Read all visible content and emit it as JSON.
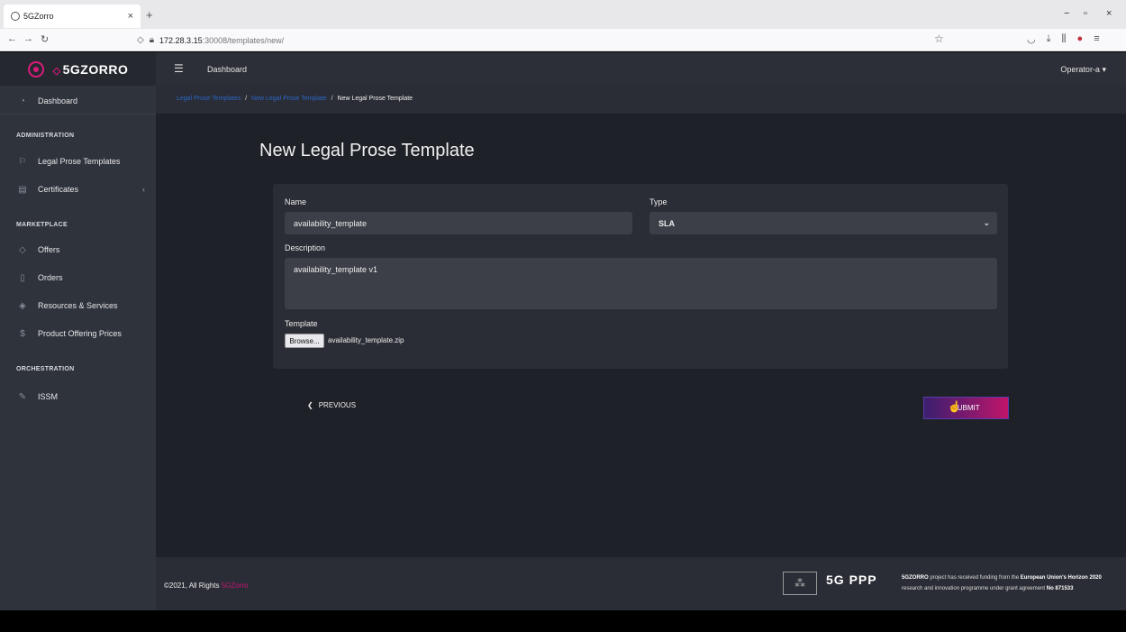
{
  "browser": {
    "tab_title": "5GZorro",
    "tab_close": "×",
    "new_tab": "+",
    "url_host": "172.28.3.15",
    "url_path": ":30008/templates/new/",
    "win_min": "−",
    "win_max": "▫",
    "win_close": "×"
  },
  "sidebar": {
    "logo": "5GZORRO",
    "items": [
      {
        "label": "Dashboard",
        "icon": "gauge-icon"
      },
      {
        "label": "Legal Prose Templates",
        "icon": "flag-icon"
      },
      {
        "label": "Certificates",
        "icon": "certificate-icon"
      },
      {
        "label": "Offers",
        "icon": "tag-icon"
      },
      {
        "label": "Orders",
        "icon": "bookmark-icon"
      },
      {
        "label": "Resources & Services",
        "icon": "layers-icon"
      },
      {
        "label": "Product Offering Prices",
        "icon": "dollar-icon"
      },
      {
        "label": "ISSM",
        "icon": "pen-icon"
      }
    ],
    "sections": {
      "administration": "ADMINISTRATION",
      "marketplace": "MARKETPLACE",
      "orchestration": "ORCHESTRATION"
    }
  },
  "topbar": {
    "title": "Dashboard",
    "user": "Operator-a"
  },
  "breadcrumb": {
    "item1": "Legal Prose Templates",
    "item2": "New Legal Prose Template",
    "current": "New Legal Prose Template",
    "sep": "/"
  },
  "form": {
    "page_title": "New Legal Prose Template",
    "name_label": "Name",
    "name_value": "availability_template",
    "type_label": "Type",
    "type_value": "SLA",
    "description_label": "Description",
    "description_value": "availability_template v1",
    "template_label": "Template",
    "browse_label": "Browse...",
    "file_name": "availability_template.zip",
    "previous_label": "PREVIOUS",
    "submit_label": "SUBMIT"
  },
  "footer": {
    "copyright": "©2021, All Rights",
    "brand": "5GZorro",
    "ppp": "5G PPP",
    "funding_lead": "5GZORRO",
    "funding_text": "project has received funding from the",
    "funding_prog": "European Union's Horizon 2020",
    "funding_text2": "research and innovation programme under grant agreement",
    "grant": "No 871533"
  },
  "colors": {
    "accent": "#d81b7a",
    "link": "#2c65c8",
    "content_bg": "#1f2128",
    "sidebar_bg": "#2f333b"
  }
}
